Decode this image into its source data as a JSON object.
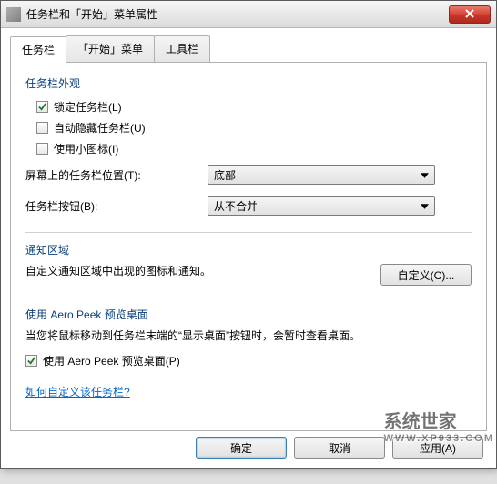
{
  "window": {
    "title": "任务栏和「开始」菜单属性"
  },
  "tabs": {
    "taskbar": "任务栏",
    "startmenu": "「开始」菜单",
    "toolbars": "工具栏"
  },
  "appearance": {
    "title": "任务栏外观",
    "lock": "锁定任务栏(L)",
    "autohide": "自动隐藏任务栏(U)",
    "smallicons": "使用小图标(I)",
    "position_label": "屏幕上的任务栏位置(T):",
    "position_value": "底部",
    "buttons_label": "任务栏按钮(B):",
    "buttons_value": "从不合并"
  },
  "notify": {
    "title": "通知区域",
    "desc": "自定义通知区域中出现的图标和通知。",
    "customize_btn": "自定义(C)..."
  },
  "aeropeek": {
    "title": "使用 Aero Peek 预览桌面",
    "desc": "当您将鼠标移动到任务栏末端的“显示桌面”按钮时，会暂时查看桌面。",
    "checkbox": "使用 Aero Peek 预览桌面(P)"
  },
  "link": "如何自定义该任务栏?",
  "buttons": {
    "ok": "确定",
    "cancel": "取消",
    "apply": "应用(A)"
  },
  "watermark": {
    "main": "系统世家",
    "sub": "WWW.XP933.COM"
  }
}
